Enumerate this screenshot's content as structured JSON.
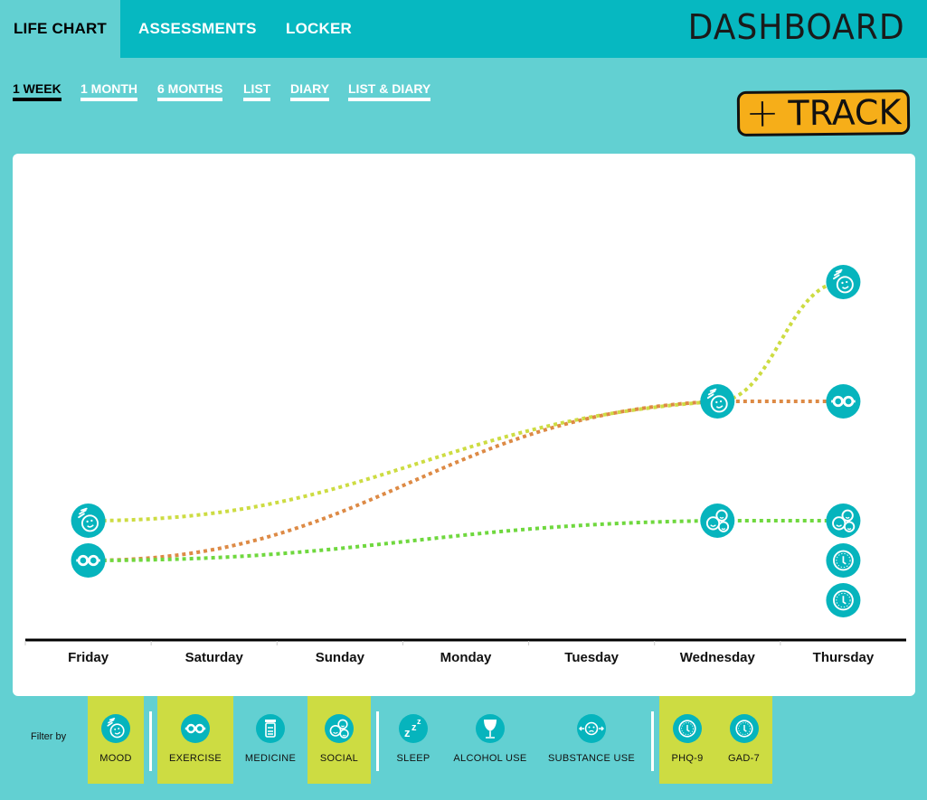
{
  "header": {
    "tabs": [
      {
        "label": "LIFE CHART",
        "active": true
      },
      {
        "label": "ASSESSMENTS",
        "active": false
      },
      {
        "label": "LOCKER",
        "active": false
      }
    ],
    "brand": "DASHBOARD"
  },
  "ranges": [
    {
      "label": "1 WEEK",
      "active": true
    },
    {
      "label": "1 MONTH",
      "active": false
    },
    {
      "label": "6 MONTHS",
      "active": false
    },
    {
      "label": "LIST",
      "active": false
    },
    {
      "label": "DIARY",
      "active": false
    },
    {
      "label": "LIST & DIARY",
      "active": false
    }
  ],
  "track_button": {
    "plus": "+",
    "label": "TRACK"
  },
  "colors": {
    "accent": "#06b8c1",
    "background": "#62d0d2",
    "icon": "#06b4bd",
    "filter_active": "#cddc42",
    "track_button": "#f6ae19",
    "mood_line": "#cddc42",
    "exercise_line": "#dd8a45",
    "social_line": "#6fd83e"
  },
  "chart_data": {
    "type": "line",
    "title": "",
    "xlabel": "",
    "ylabel": "",
    "categories": [
      "Friday",
      "Saturday",
      "Sunday",
      "Monday",
      "Tuesday",
      "Wednesday",
      "Thursday"
    ],
    "ylim": [
      0,
      11
    ],
    "grid": false,
    "legend": "none",
    "series": [
      {
        "name": "Mood",
        "icon": "mood-icon",
        "color": "#cddc42",
        "points": [
          {
            "x": "Friday",
            "y": 3
          },
          {
            "x": "Wednesday",
            "y": 6
          },
          {
            "x": "Thursday",
            "y": 9
          }
        ],
        "markers": true
      },
      {
        "name": "Exercise",
        "icon": "exercise-icon",
        "color": "#dd8a45",
        "points": [
          {
            "x": "Friday",
            "y": 2
          },
          {
            "x": "Wednesday",
            "y": 6
          },
          {
            "x": "Thursday",
            "y": 6
          }
        ],
        "markers": [
          true,
          false,
          true
        ]
      },
      {
        "name": "Social",
        "icon": "social-icon",
        "color": "#6fd83e",
        "points": [
          {
            "x": "Friday",
            "y": 2
          },
          {
            "x": "Wednesday",
            "y": 3
          },
          {
            "x": "Thursday",
            "y": 3
          }
        ],
        "markers": [
          false,
          true,
          true
        ]
      },
      {
        "name": "PHQ-9",
        "icon": "assessment-clock-icon",
        "color": "#06b4bd",
        "points": [
          {
            "x": "Thursday",
            "y": 2
          }
        ],
        "markers": true
      },
      {
        "name": "GAD-7",
        "icon": "assessment-clock-icon",
        "color": "#06b4bd",
        "points": [
          {
            "x": "Thursday",
            "y": 1
          }
        ],
        "markers": true
      }
    ]
  },
  "filters": {
    "label": "Filter by",
    "items": [
      {
        "label": "MOOD",
        "icon": "mood-icon",
        "active": true
      },
      {
        "label": "EXERCISE",
        "icon": "exercise-icon",
        "active": true
      },
      {
        "label": "MEDICINE",
        "icon": "medicine-icon",
        "active": false
      },
      {
        "label": "SOCIAL",
        "icon": "social-icon",
        "active": true
      },
      {
        "label": "SLEEP",
        "icon": "sleep-icon",
        "active": false
      },
      {
        "label": "ALCOHOL USE",
        "icon": "alcohol-icon",
        "active": false
      },
      {
        "label": "SUBSTANCE USE",
        "icon": "substance-icon",
        "active": false
      },
      {
        "label": "PHQ-9",
        "icon": "assessment-clock-icon",
        "active": true
      },
      {
        "label": "GAD-7",
        "icon": "assessment-clock-icon",
        "active": true
      }
    ]
  }
}
